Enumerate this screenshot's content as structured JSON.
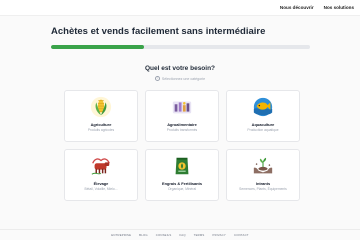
{
  "nav": {
    "links": [
      "Nous découvrir",
      "Nos solutions"
    ]
  },
  "title": "Achètes et vends facilement sans intermédiaire",
  "progress": {
    "fraction": 0.36,
    "color": "#3aa34a"
  },
  "question": "Quel est votre besoin?",
  "hint": "Sélectionnez une catégorie",
  "categories": [
    {
      "label": "Agriculture",
      "sub": "Produits agricoles",
      "icon": "corn-icon"
    },
    {
      "label": "Agroalimentaire",
      "sub": "Produits transformés",
      "icon": "factory-icon"
    },
    {
      "label": "Aquaculture",
      "sub": "Production aquatique",
      "icon": "fish-icon"
    },
    {
      "label": "Élevage",
      "sub": "Bétail, Volaille, Mielo...",
      "icon": "cow-icon"
    },
    {
      "label": "Engrais & Fertilisants",
      "sub": "Organique, Minéral",
      "icon": "fertilizer-bag-icon"
    },
    {
      "label": "Intrants",
      "sub": "Semences, Plants, Équipements",
      "icon": "seedling-hands-icon"
    }
  ],
  "footer": {
    "links": [
      "ENTREPRISE",
      "BLOG",
      "CONSEILS",
      "FAQ",
      "TERMS",
      "PRIVACY",
      "CONTACT"
    ]
  }
}
